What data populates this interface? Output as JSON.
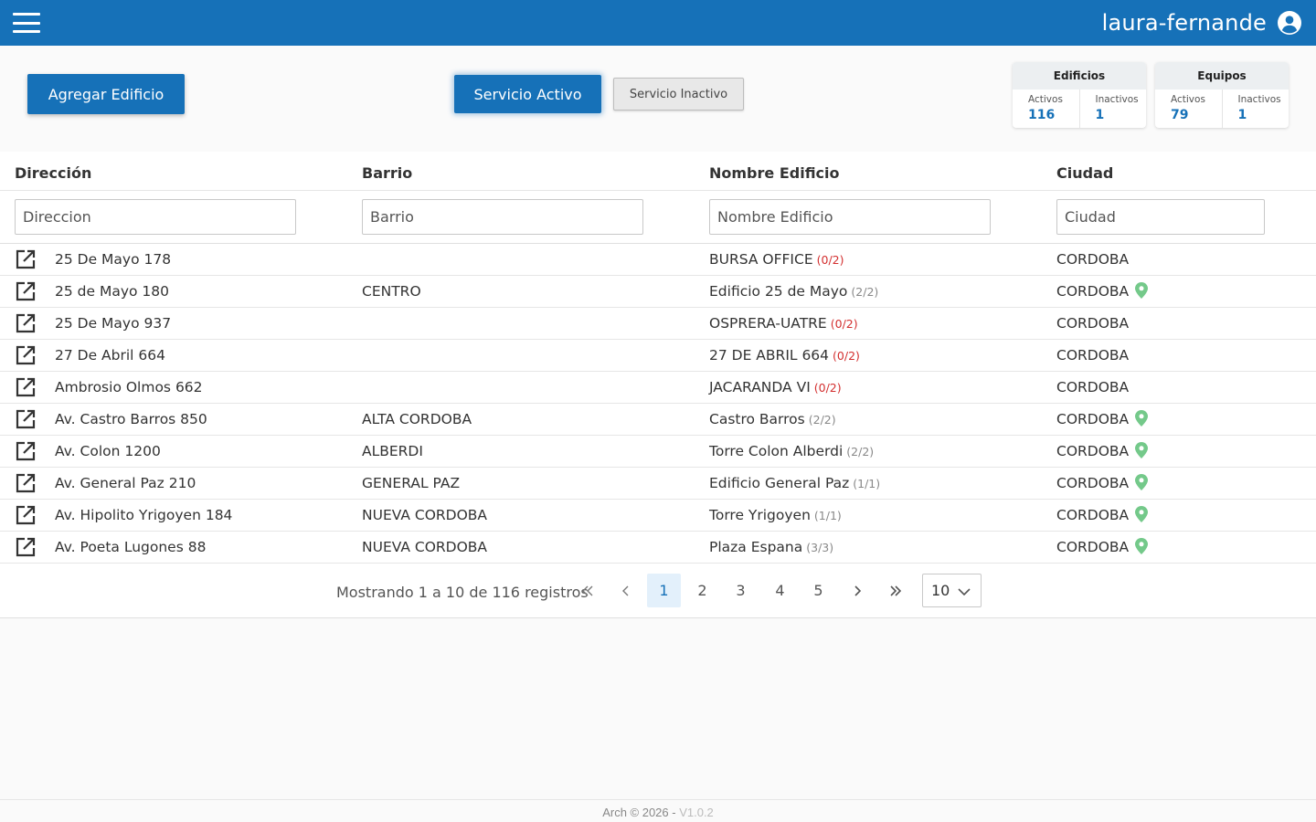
{
  "header": {
    "user_name": "laura-fernande",
    "accent_color": "#1671b8"
  },
  "toolbar": {
    "add_label": "Agregar Edificio",
    "active_label": "Servicio Activo",
    "inactive_label": "Servicio Inactivo"
  },
  "stats": {
    "edificios": {
      "title": "Edificios",
      "active_label": "Activos",
      "active_value": "116",
      "inactive_label": "Inactivos",
      "inactive_value": "1"
    },
    "equipos": {
      "title": "Equipos",
      "active_label": "Activos",
      "active_value": "79",
      "inactive_label": "Inactivos",
      "inactive_value": "1"
    }
  },
  "table": {
    "columns": [
      "Dirección",
      "Barrio",
      "Nombre Edificio",
      "Ciudad"
    ],
    "filters": [
      "Direccion",
      "Barrio",
      "Nombre Edificio",
      "Ciudad"
    ],
    "rows": [
      {
        "direccion": "25 De Mayo 178",
        "barrio": "",
        "nombre": "BURSA OFFICE",
        "equipos": "(0/2)",
        "ciudad": "CORDOBA",
        "location": false
      },
      {
        "direccion": "25 de Mayo 180",
        "barrio": "CENTRO",
        "nombre": "Edificio 25 de Mayo",
        "equipos": "(2/2)",
        "ciudad": "CORDOBA",
        "location": true
      },
      {
        "direccion": "25 De Mayo 937",
        "barrio": "",
        "nombre": "OSPRERA-UATRE",
        "equipos": "(0/2)",
        "ciudad": "CORDOBA",
        "location": false
      },
      {
        "direccion": "27 De Abril 664",
        "barrio": "",
        "nombre": "27 DE ABRIL 664",
        "equipos": "(0/2)",
        "ciudad": "CORDOBA",
        "location": false
      },
      {
        "direccion": "Ambrosio Olmos 662",
        "barrio": "",
        "nombre": "JACARANDA VI",
        "equipos": "(0/2)",
        "ciudad": "CORDOBA",
        "location": false
      },
      {
        "direccion": "Av. Castro Barros 850",
        "barrio": "ALTA CORDOBA",
        "nombre": "Castro Barros",
        "equipos": "(2/2)",
        "ciudad": "CORDOBA",
        "location": true
      },
      {
        "direccion": "Av. Colon 1200",
        "barrio": "ALBERDI",
        "nombre": "Torre Colon Alberdi",
        "equipos": "(2/2)",
        "ciudad": "CORDOBA",
        "location": true
      },
      {
        "direccion": "Av. General Paz 210",
        "barrio": "GENERAL PAZ",
        "nombre": "Edificio General Paz",
        "equipos": "(1/1)",
        "ciudad": "CORDOBA",
        "location": true
      },
      {
        "direccion": "Av. Hipolito Yrigoyen 184",
        "barrio": "NUEVA CORDOBA",
        "nombre": "Torre Yrigoyen",
        "equipos": "(1/1)",
        "ciudad": "CORDOBA",
        "location": true
      },
      {
        "direccion": "Av. Poeta Lugones 88",
        "barrio": "NUEVA CORDOBA",
        "nombre": "Plaza Espana",
        "equipos": "(3/3)",
        "ciudad": "CORDOBA",
        "location": true
      }
    ]
  },
  "pagination": {
    "info": "Mostrando 1 a 10 de 116 registros",
    "pages": [
      "1",
      "2",
      "3",
      "4",
      "5"
    ],
    "current_page": "1",
    "rows_per_page": "10"
  },
  "footer": {
    "copyright": "Arch © 2026 - ",
    "version": "V1.0.2"
  }
}
